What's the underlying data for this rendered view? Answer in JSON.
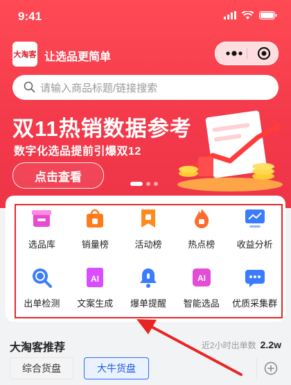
{
  "status": {
    "time": "9:41"
  },
  "header": {
    "logo_text": "大淘客",
    "slogan": "让选品更简单"
  },
  "search": {
    "placeholder": "请输入商品标题/链接搜索"
  },
  "banner": {
    "title": "双11热销数据参考",
    "subtitle": "数字化选品提前引爆双12",
    "cta_label": "点击查看"
  },
  "features": [
    {
      "label": "选品库",
      "icon": "store-icon",
      "color": "#e94ad1"
    },
    {
      "label": "销量榜",
      "icon": "shopping-bag-icon",
      "color": "#ff7b1c"
    },
    {
      "label": "活动榜",
      "icon": "ribbon-icon",
      "color": "#ff8a1f"
    },
    {
      "label": "热点榜",
      "icon": "fire-icon",
      "color": "#ff6b2a"
    },
    {
      "label": "收益分析",
      "icon": "chart-monitor-icon",
      "color": "#3a7bff"
    },
    {
      "label": "出单检测",
      "icon": "magnifier-icon",
      "color": "#3a7bff"
    },
    {
      "label": "文案生成",
      "icon": "ai-doc-icon",
      "color": "#d94cff"
    },
    {
      "label": "爆单提醒",
      "icon": "bell-icon",
      "color": "#3a7bff"
    },
    {
      "label": "智能选品",
      "icon": "ai-chip-icon",
      "color": "#e44bd6"
    },
    {
      "label": "优质采集群",
      "icon": "chat-bubble-icon",
      "color": "#3a7bff"
    }
  ],
  "recommend": {
    "title": "大淘客推荐",
    "meta_label": "近2小时出单数",
    "meta_value": "2.2w",
    "tabs": [
      "综合货盘",
      "大牛货盘"
    ]
  },
  "colors": {
    "brand_red": "#f23a4b",
    "highlight_red": "#e82525",
    "accent_blue": "#2b6aff"
  }
}
